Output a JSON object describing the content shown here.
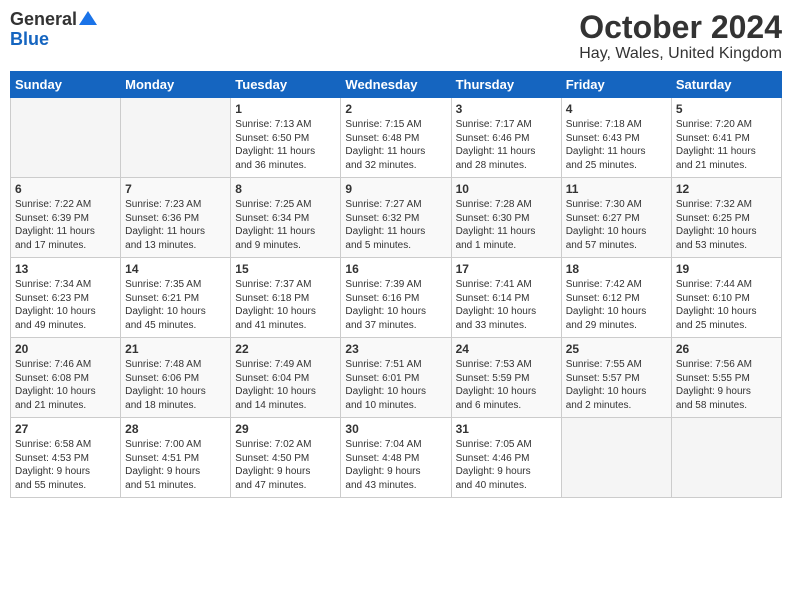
{
  "logo": {
    "general": "General",
    "blue": "Blue"
  },
  "title": "October 2024",
  "location": "Hay, Wales, United Kingdom",
  "days_of_week": [
    "Sunday",
    "Monday",
    "Tuesday",
    "Wednesday",
    "Thursday",
    "Friday",
    "Saturday"
  ],
  "weeks": [
    [
      {
        "day": "",
        "content": ""
      },
      {
        "day": "",
        "content": ""
      },
      {
        "day": "1",
        "content": "Sunrise: 7:13 AM\nSunset: 6:50 PM\nDaylight: 11 hours\nand 36 minutes."
      },
      {
        "day": "2",
        "content": "Sunrise: 7:15 AM\nSunset: 6:48 PM\nDaylight: 11 hours\nand 32 minutes."
      },
      {
        "day": "3",
        "content": "Sunrise: 7:17 AM\nSunset: 6:46 PM\nDaylight: 11 hours\nand 28 minutes."
      },
      {
        "day": "4",
        "content": "Sunrise: 7:18 AM\nSunset: 6:43 PM\nDaylight: 11 hours\nand 25 minutes."
      },
      {
        "day": "5",
        "content": "Sunrise: 7:20 AM\nSunset: 6:41 PM\nDaylight: 11 hours\nand 21 minutes."
      }
    ],
    [
      {
        "day": "6",
        "content": "Sunrise: 7:22 AM\nSunset: 6:39 PM\nDaylight: 11 hours\nand 17 minutes."
      },
      {
        "day": "7",
        "content": "Sunrise: 7:23 AM\nSunset: 6:36 PM\nDaylight: 11 hours\nand 13 minutes."
      },
      {
        "day": "8",
        "content": "Sunrise: 7:25 AM\nSunset: 6:34 PM\nDaylight: 11 hours\nand 9 minutes."
      },
      {
        "day": "9",
        "content": "Sunrise: 7:27 AM\nSunset: 6:32 PM\nDaylight: 11 hours\nand 5 minutes."
      },
      {
        "day": "10",
        "content": "Sunrise: 7:28 AM\nSunset: 6:30 PM\nDaylight: 11 hours\nand 1 minute."
      },
      {
        "day": "11",
        "content": "Sunrise: 7:30 AM\nSunset: 6:27 PM\nDaylight: 10 hours\nand 57 minutes."
      },
      {
        "day": "12",
        "content": "Sunrise: 7:32 AM\nSunset: 6:25 PM\nDaylight: 10 hours\nand 53 minutes."
      }
    ],
    [
      {
        "day": "13",
        "content": "Sunrise: 7:34 AM\nSunset: 6:23 PM\nDaylight: 10 hours\nand 49 minutes."
      },
      {
        "day": "14",
        "content": "Sunrise: 7:35 AM\nSunset: 6:21 PM\nDaylight: 10 hours\nand 45 minutes."
      },
      {
        "day": "15",
        "content": "Sunrise: 7:37 AM\nSunset: 6:18 PM\nDaylight: 10 hours\nand 41 minutes."
      },
      {
        "day": "16",
        "content": "Sunrise: 7:39 AM\nSunset: 6:16 PM\nDaylight: 10 hours\nand 37 minutes."
      },
      {
        "day": "17",
        "content": "Sunrise: 7:41 AM\nSunset: 6:14 PM\nDaylight: 10 hours\nand 33 minutes."
      },
      {
        "day": "18",
        "content": "Sunrise: 7:42 AM\nSunset: 6:12 PM\nDaylight: 10 hours\nand 29 minutes."
      },
      {
        "day": "19",
        "content": "Sunrise: 7:44 AM\nSunset: 6:10 PM\nDaylight: 10 hours\nand 25 minutes."
      }
    ],
    [
      {
        "day": "20",
        "content": "Sunrise: 7:46 AM\nSunset: 6:08 PM\nDaylight: 10 hours\nand 21 minutes."
      },
      {
        "day": "21",
        "content": "Sunrise: 7:48 AM\nSunset: 6:06 PM\nDaylight: 10 hours\nand 18 minutes."
      },
      {
        "day": "22",
        "content": "Sunrise: 7:49 AM\nSunset: 6:04 PM\nDaylight: 10 hours\nand 14 minutes."
      },
      {
        "day": "23",
        "content": "Sunrise: 7:51 AM\nSunset: 6:01 PM\nDaylight: 10 hours\nand 10 minutes."
      },
      {
        "day": "24",
        "content": "Sunrise: 7:53 AM\nSunset: 5:59 PM\nDaylight: 10 hours\nand 6 minutes."
      },
      {
        "day": "25",
        "content": "Sunrise: 7:55 AM\nSunset: 5:57 PM\nDaylight: 10 hours\nand 2 minutes."
      },
      {
        "day": "26",
        "content": "Sunrise: 7:56 AM\nSunset: 5:55 PM\nDaylight: 9 hours\nand 58 minutes."
      }
    ],
    [
      {
        "day": "27",
        "content": "Sunrise: 6:58 AM\nSunset: 4:53 PM\nDaylight: 9 hours\nand 55 minutes."
      },
      {
        "day": "28",
        "content": "Sunrise: 7:00 AM\nSunset: 4:51 PM\nDaylight: 9 hours\nand 51 minutes."
      },
      {
        "day": "29",
        "content": "Sunrise: 7:02 AM\nSunset: 4:50 PM\nDaylight: 9 hours\nand 47 minutes."
      },
      {
        "day": "30",
        "content": "Sunrise: 7:04 AM\nSunset: 4:48 PM\nDaylight: 9 hours\nand 43 minutes."
      },
      {
        "day": "31",
        "content": "Sunrise: 7:05 AM\nSunset: 4:46 PM\nDaylight: 9 hours\nand 40 minutes."
      },
      {
        "day": "",
        "content": ""
      },
      {
        "day": "",
        "content": ""
      }
    ]
  ]
}
